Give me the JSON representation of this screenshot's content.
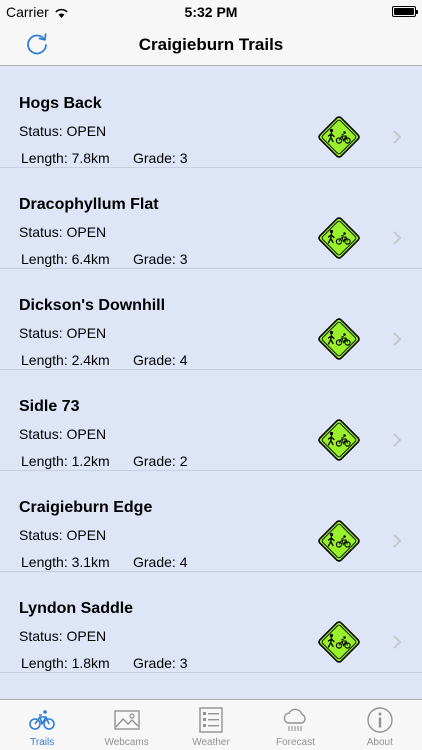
{
  "status_bar": {
    "carrier": "Carrier",
    "time": "5:32 PM",
    "battery_level": 1.0
  },
  "nav": {
    "title": "Craigieburn Trails",
    "refresh_icon": "refresh-icon"
  },
  "trails": [
    {
      "name": "Hogs Back",
      "status": "Status: OPEN",
      "length": "Length: 7.8km",
      "grade": "Grade: 3"
    },
    {
      "name": "Dracophyllum Flat",
      "status": "Status: OPEN",
      "length": "Length: 6.4km",
      "grade": "Grade: 3"
    },
    {
      "name": "Dickson's Downhill",
      "status": "Status: OPEN",
      "length": "Length: 2.4km",
      "grade": "Grade: 4"
    },
    {
      "name": "Sidle 73",
      "status": "Status: OPEN",
      "length": "Length: 1.2km",
      "grade": "Grade: 2"
    },
    {
      "name": "Craigieburn Edge",
      "status": "Status: OPEN",
      "length": "Length: 3.1km",
      "grade": "Grade: 4"
    },
    {
      "name": "Lyndon Saddle",
      "status": "Status: OPEN",
      "length": "Length: 1.8km",
      "grade": "Grade: 3"
    }
  ],
  "trail_sign_icon": "walker-cyclist-sign-icon",
  "tabs": [
    {
      "label": "Trails",
      "icon": "bicycle-icon",
      "active": true
    },
    {
      "label": "Webcams",
      "icon": "image-icon",
      "active": false
    },
    {
      "label": "Weather",
      "icon": "list-icon",
      "active": false
    },
    {
      "label": "Forecast",
      "icon": "rain-cloud-icon",
      "active": false
    },
    {
      "label": "About",
      "icon": "info-icon",
      "active": false
    }
  ],
  "colors": {
    "accent": "#2f7ed8",
    "sign_fill": "#9af02b",
    "list_bg": "#dde5f6",
    "bar_bg": "#f7f7f7"
  }
}
